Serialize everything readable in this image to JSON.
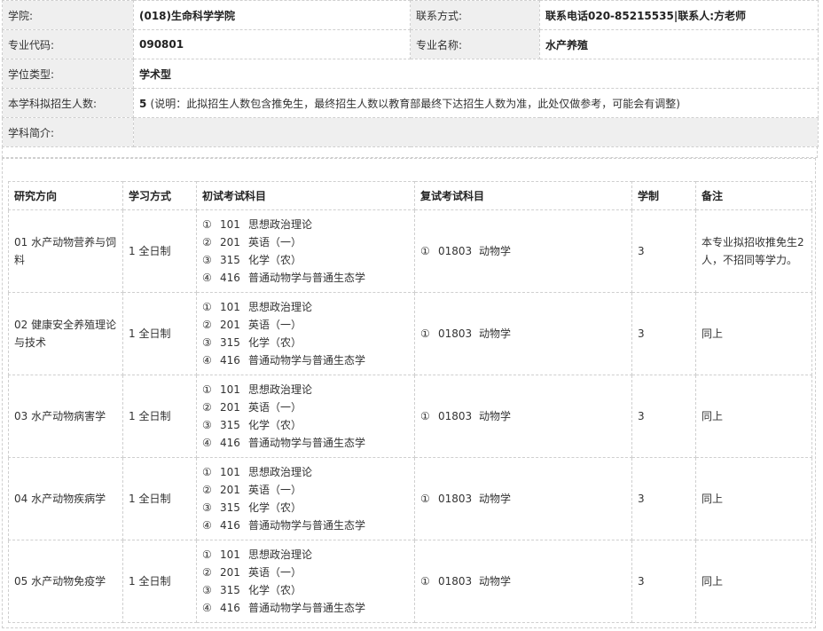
{
  "info": {
    "college_label": "学院:",
    "college_value": "(018)生命科学学院",
    "contact_label": "联系方式:",
    "contact_value": "联系电话020-85215535|联系人:方老师",
    "major_code_label": "专业代码:",
    "major_code_value": "090801",
    "major_name_label": "专业名称:",
    "major_name_value": "水产养殖",
    "degree_type_label": "学位类型:",
    "degree_type_value": "学术型",
    "enroll_label": "本学科拟招生人数:",
    "enroll_value": "5",
    "enroll_note": "(说明：此拟招生人数包含推免生，最终招生人数以教育部最终下达招生人数为准，此处仅做参考，可能会有调整)",
    "intro_label": "学科简介:"
  },
  "table": {
    "headers": [
      "研究方向",
      "学习方式",
      "初试考试科目",
      "复试考试科目",
      "学制",
      "备注"
    ],
    "rows": [
      {
        "direction": "01 水产动物营养与饲料",
        "mode": "1 全日制",
        "exams": [
          {
            "num": "①",
            "code": "101",
            "name": "思想政治理论"
          },
          {
            "num": "②",
            "code": "201",
            "name": "英语（一）"
          },
          {
            "num": "③",
            "code": "315",
            "name": "化学（农）"
          },
          {
            "num": "④",
            "code": "416",
            "name": "普通动物学与普通生态学"
          }
        ],
        "retest": {
          "num": "①",
          "code": "01803",
          "name": "动物学"
        },
        "years": "3",
        "note": "本专业拟招收推免生2人，不招同等学力。"
      },
      {
        "direction": "02 健康安全养殖理论与技术",
        "mode": "1 全日制",
        "exams": [
          {
            "num": "①",
            "code": "101",
            "name": "思想政治理论"
          },
          {
            "num": "②",
            "code": "201",
            "name": "英语（一）"
          },
          {
            "num": "③",
            "code": "315",
            "name": "化学（农）"
          },
          {
            "num": "④",
            "code": "416",
            "name": "普通动物学与普通生态学"
          }
        ],
        "retest": {
          "num": "①",
          "code": "01803",
          "name": "动物学"
        },
        "years": "3",
        "note": "同上"
      },
      {
        "direction": "03 水产动物病害学",
        "mode": "1 全日制",
        "exams": [
          {
            "num": "①",
            "code": "101",
            "name": "思想政治理论"
          },
          {
            "num": "②",
            "code": "201",
            "name": "英语（一）"
          },
          {
            "num": "③",
            "code": "315",
            "name": "化学（农）"
          },
          {
            "num": "④",
            "code": "416",
            "name": "普通动物学与普通生态学"
          }
        ],
        "retest": {
          "num": "①",
          "code": "01803",
          "name": "动物学"
        },
        "years": "3",
        "note": "同上"
      },
      {
        "direction": "04 水产动物疾病学",
        "mode": "1 全日制",
        "exams": [
          {
            "num": "①",
            "code": "101",
            "name": "思想政治理论"
          },
          {
            "num": "②",
            "code": "201",
            "name": "英语（一）"
          },
          {
            "num": "③",
            "code": "315",
            "name": "化学（农）"
          },
          {
            "num": "④",
            "code": "416",
            "name": "普通动物学与普通生态学"
          }
        ],
        "retest": {
          "num": "①",
          "code": "01803",
          "name": "动物学"
        },
        "years": "3",
        "note": "同上"
      },
      {
        "direction": "05 水产动物免疫学",
        "mode": "1 全日制",
        "exams": [
          {
            "num": "①",
            "code": "101",
            "name": "思想政治理论"
          },
          {
            "num": "②",
            "code": "201",
            "name": "英语（一）"
          },
          {
            "num": "③",
            "code": "315",
            "name": "化学（农）"
          },
          {
            "num": "④",
            "code": "416",
            "name": "普通动物学与普通生态学"
          }
        ],
        "retest": {
          "num": "①",
          "code": "01803",
          "name": "动物学"
        },
        "years": "3",
        "note": "同上"
      }
    ]
  }
}
